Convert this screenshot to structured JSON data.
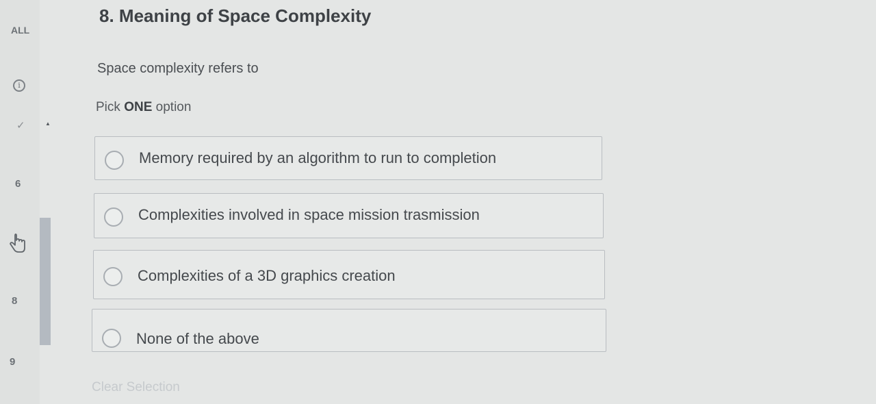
{
  "sidebar": {
    "filter_label": "ALL",
    "items": [
      {
        "label": "6"
      },
      {
        "label": "8"
      },
      {
        "label": "9"
      }
    ],
    "icons": [
      "info-icon",
      "check-icon",
      "collapse-arrow-icon",
      "hand-pointer-icon"
    ]
  },
  "question": {
    "title": "8. Meaning of Space Complexity",
    "text": "Space complexity refers to",
    "instruction_prefix": "Pick",
    "instruction_emphasis": "ONE",
    "instruction_suffix": "option"
  },
  "options": [
    {
      "label": "Memory required by an algorithm to run to completion",
      "selected": false
    },
    {
      "label": "Complexities involved in space mission trasmission",
      "selected": false
    },
    {
      "label": "Complexities of a 3D graphics creation",
      "selected": false
    },
    {
      "label": "None of the above",
      "selected": false
    }
  ],
  "actions": {
    "clear_label": "Clear Selection"
  }
}
